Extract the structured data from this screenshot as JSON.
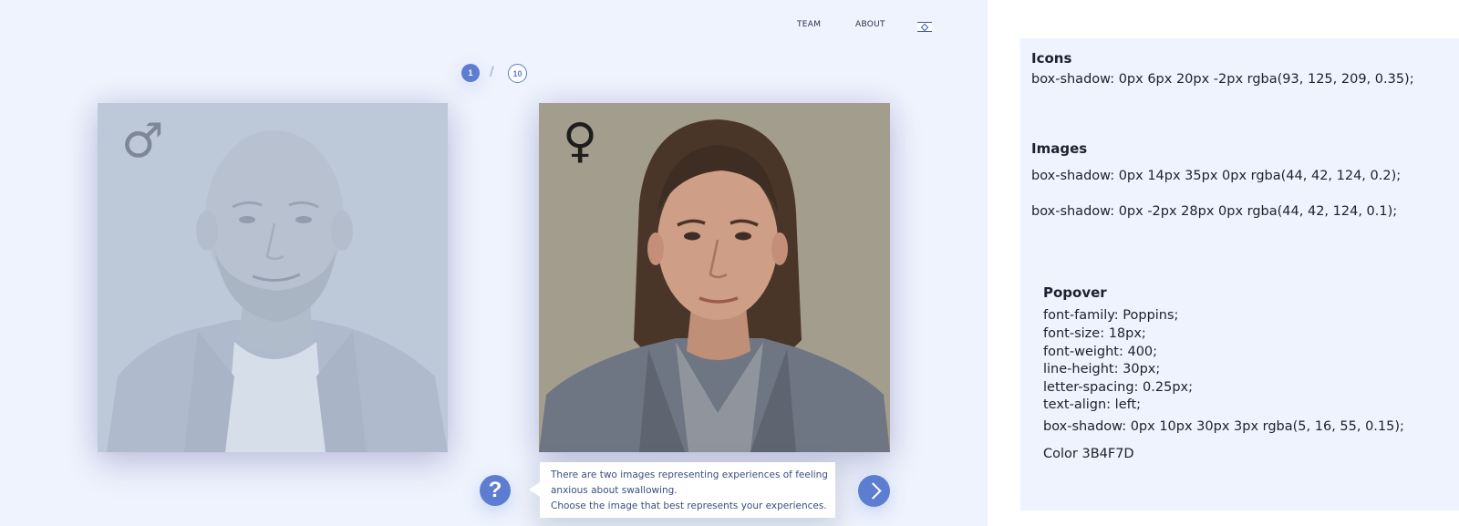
{
  "nav": {
    "team": "TEAM",
    "about": "ABOUT",
    "language_flag_icon": "israel-flag-icon"
  },
  "pager": {
    "current": "1",
    "total": "10"
  },
  "cards": {
    "male": {
      "gender_symbol": "♂",
      "icon": "male-symbol-icon"
    },
    "female": {
      "gender_symbol": "♀",
      "icon": "female-symbol-icon"
    }
  },
  "help_button": {
    "glyph": "?"
  },
  "popover": {
    "line1": "There are two images representing experiences of feeling",
    "line2": "anxious about swallowing.",
    "line3": "Choose the image that best represents your experiences."
  },
  "spec": {
    "icons_title": "Icons",
    "icons_shadow": "box-shadow: 0px 6px 20px -2px rgba(93, 125, 209, 0.35);",
    "images_title": "Images",
    "images_shadow_1": "box-shadow: 0px 14px 35px 0px rgba(44, 42, 124, 0.2);",
    "images_shadow_2": "box-shadow: 0px -2px 28px 0px rgba(44, 42, 124, 0.1);",
    "popover_title": "Popover",
    "font_family": "font-family: Poppins;",
    "font_size": "font-size: 18px;",
    "font_weight": "font-weight: 400;",
    "line_height": "line-height: 30px;",
    "letter_spacing": "letter-spacing: 0.25px;",
    "text_align": "text-align: left;",
    "popover_shadow": "box-shadow: 0px 10px 30px 3px rgba(5, 16, 55, 0.15);",
    "color": "Color 3B4F7D"
  },
  "colors": {
    "accent": "#5d7dd1",
    "popover_text": "#3B4F7D",
    "canvas": "#eef3fd"
  }
}
